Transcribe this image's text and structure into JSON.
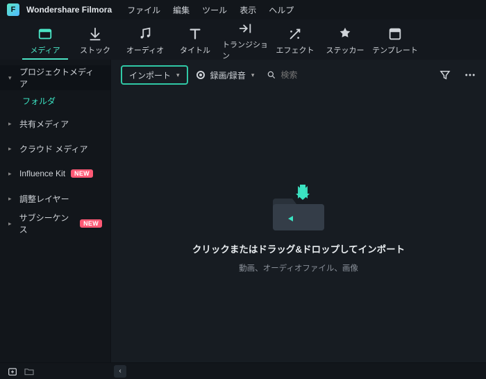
{
  "app": {
    "title": "Wondershare Filmora"
  },
  "menu": {
    "items": [
      "ファイル",
      "編集",
      "ツール",
      "表示",
      "ヘルプ"
    ]
  },
  "toolbar": {
    "tabs": [
      {
        "label": "メディア",
        "icon": "media-icon",
        "active": true
      },
      {
        "label": "ストック",
        "icon": "stock-icon"
      },
      {
        "label": "オーディオ",
        "icon": "audio-icon"
      },
      {
        "label": "タイトル",
        "icon": "title-icon"
      },
      {
        "label": "トランジション",
        "icon": "transition-icon"
      },
      {
        "label": "エフェクト",
        "icon": "effect-icon"
      },
      {
        "label": "ステッカー",
        "icon": "sticker-icon"
      },
      {
        "label": "テンプレート",
        "icon": "template-icon"
      }
    ]
  },
  "sidebar": {
    "items": [
      {
        "label": "プロジェクトメディア",
        "expanded": true,
        "children": [
          {
            "label": "フォルダ",
            "selected": true
          }
        ]
      },
      {
        "label": "共有メディア"
      },
      {
        "label": "クラウド メディア"
      },
      {
        "label": "Influence Kit",
        "badge": "NEW"
      },
      {
        "label": "調整レイヤー"
      },
      {
        "label": "サブシーケンス",
        "badge": "NEW"
      }
    ]
  },
  "contentbar": {
    "import_label": "インポート",
    "record_label": "録画/録音",
    "search_placeholder": "検索"
  },
  "drop": {
    "title": "クリックまたはドラッグ&ドロップしてインポート",
    "subtitle": "動画、オーディオファイル、画像"
  }
}
